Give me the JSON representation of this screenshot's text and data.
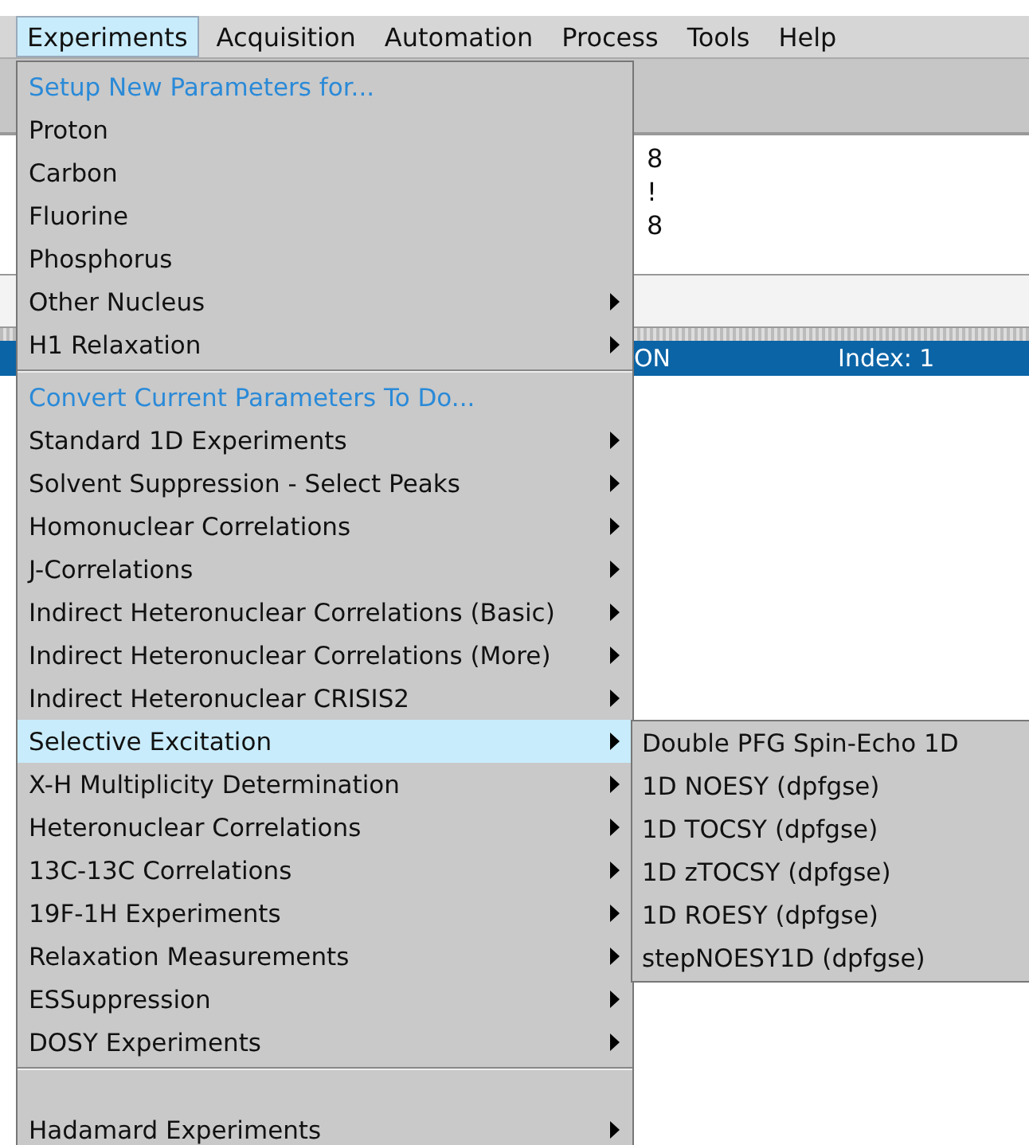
{
  "menubar": [
    {
      "label": "Experiments",
      "selected": true
    },
    {
      "label": "Acquisition",
      "selected": false
    },
    {
      "label": "Automation",
      "selected": false
    },
    {
      "label": "Process",
      "selected": false
    },
    {
      "label": "Tools",
      "selected": false
    },
    {
      "label": "Help",
      "selected": false
    }
  ],
  "log_lines": [
    "8",
    "!",
    "8"
  ],
  "status_bar": {
    "mode": "ON",
    "index": "Index: 1"
  },
  "menu": {
    "items": [
      {
        "kind": "header",
        "label": "Setup New Parameters for..."
      },
      {
        "kind": "item",
        "label": "Proton",
        "submenu": false,
        "selected": false
      },
      {
        "kind": "item",
        "label": "Carbon",
        "submenu": false,
        "selected": false
      },
      {
        "kind": "item",
        "label": "Fluorine",
        "submenu": false,
        "selected": false
      },
      {
        "kind": "item",
        "label": "Phosphorus",
        "submenu": false,
        "selected": false
      },
      {
        "kind": "item",
        "label": "Other Nucleus",
        "submenu": true,
        "selected": false
      },
      {
        "kind": "item",
        "label": "H1 Relaxation",
        "submenu": true,
        "selected": false
      },
      {
        "kind": "separator"
      },
      {
        "kind": "header",
        "label": "Convert Current Parameters To Do..."
      },
      {
        "kind": "item",
        "label": "Standard 1D Experiments",
        "submenu": true,
        "selected": false
      },
      {
        "kind": "item",
        "label": "Solvent Suppression - Select Peaks",
        "submenu": true,
        "selected": false
      },
      {
        "kind": "item",
        "label": "Homonuclear Correlations",
        "submenu": true,
        "selected": false
      },
      {
        "kind": "item",
        "label": "J-Correlations",
        "submenu": true,
        "selected": false
      },
      {
        "kind": "item",
        "label": "Indirect Heteronuclear Correlations (Basic)",
        "submenu": true,
        "selected": false
      },
      {
        "kind": "item",
        "label": "Indirect Heteronuclear Correlations (More)",
        "submenu": true,
        "selected": false
      },
      {
        "kind": "item",
        "label": "Indirect Heteronuclear CRISIS2",
        "submenu": true,
        "selected": false
      },
      {
        "kind": "item",
        "label": "Selective Excitation",
        "submenu": true,
        "selected": true
      },
      {
        "kind": "item",
        "label": "X-H Multiplicity Determination",
        "submenu": true,
        "selected": false
      },
      {
        "kind": "item",
        "label": "Heteronuclear Correlations",
        "submenu": true,
        "selected": false
      },
      {
        "kind": "item",
        "label": "13C-13C Correlations",
        "submenu": true,
        "selected": false
      },
      {
        "kind": "item",
        "label": "19F-1H Experiments",
        "submenu": true,
        "selected": false
      },
      {
        "kind": "item",
        "label": "Relaxation Measurements",
        "submenu": true,
        "selected": false
      },
      {
        "kind": "item",
        "label": "ESSuppression",
        "submenu": true,
        "selected": false
      },
      {
        "kind": "item",
        "label": "DOSY Experiments",
        "submenu": true,
        "selected": false
      },
      {
        "kind": "separator"
      },
      {
        "kind": "blank"
      },
      {
        "kind": "item",
        "label": "Hadamard Experiments",
        "submenu": true,
        "selected": false
      }
    ]
  },
  "submenu": {
    "items": [
      {
        "label": "Double PFG Spin-Echo 1D"
      },
      {
        "label": "1D NOESY (dpfgse)"
      },
      {
        "label": "1D TOCSY (dpfgse)"
      },
      {
        "label": "1D zTOCSY (dpfgse)"
      },
      {
        "label": "1D ROESY (dpfgse)"
      },
      {
        "label": "stepNOESY1D (dpfgse)"
      }
    ]
  }
}
